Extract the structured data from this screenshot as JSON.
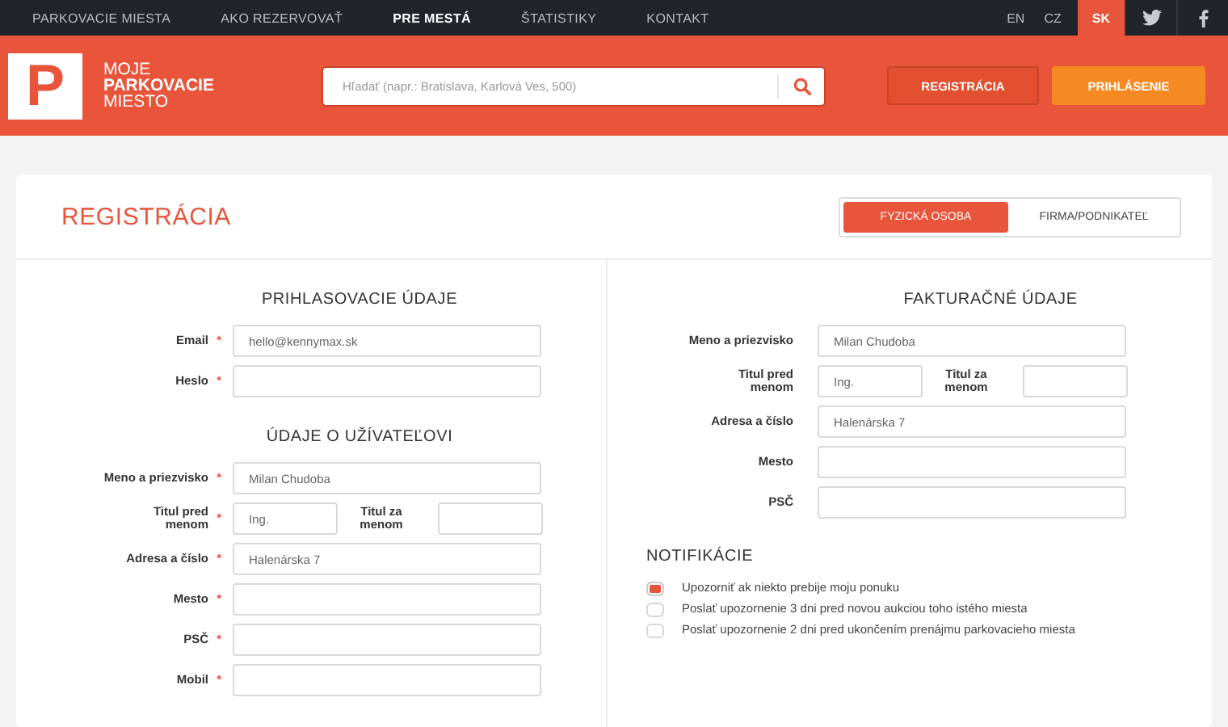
{
  "nav": {
    "items": [
      {
        "label": "PARKOVACIE MIESTA",
        "selected": false
      },
      {
        "label": "AKO REZERVOVAŤ",
        "selected": false
      },
      {
        "label": "PRE MESTÁ",
        "selected": true
      },
      {
        "label": "ŠTATISTIKY",
        "selected": false
      },
      {
        "label": "KONTAKT",
        "selected": false
      }
    ],
    "languages": [
      {
        "label": "EN",
        "selected": false
      },
      {
        "label": "CZ",
        "selected": false
      },
      {
        "label": "SK",
        "selected": true
      }
    ]
  },
  "header": {
    "logo_mark": "P",
    "logo_lines": [
      "MOJE",
      "**PARKOVACIE**",
      "MIESTO"
    ],
    "search": {
      "placeholder": "Hľadať (napr.: Bratislava, Karlová Ves, 500)"
    },
    "buttons": [
      {
        "label": "REGISTRÁCIA",
        "kind": "outline"
      },
      {
        "label": "PRIHLÁSENIE",
        "kind": "primary"
      }
    ]
  },
  "registration": {
    "title": "REGISTRÁCIA",
    "tabs": [
      {
        "label": "FYZICKÁ OSOBA",
        "selected": true
      },
      {
        "label": "FIRMA/PODNIKATEĽ",
        "selected": false
      }
    ],
    "left": [
      {
        "title": "PRIHLASOVACIE ÚDAJE",
        "fields": [
          {
            "kind": "text",
            "label": "Email",
            "marker": "*",
            "value": "hello@kennymax.sk"
          },
          {
            "kind": "text",
            "label": "Heslo",
            "marker": "*"
          }
        ]
      },
      {
        "title": "ÚDAJE O UŽÍVATEĽOVI",
        "fields": [
          {
            "kind": "text",
            "label": "Meno a priezvisko",
            "marker": "*",
            "value": "Milan Chudoba"
          },
          {
            "kind": "pair",
            "items": [
              {
                "label": "Titul pred menom",
                "marker": "*",
                "value": "Ing."
              },
              {
                "label": "Titul za menom"
              }
            ]
          },
          {
            "kind": "text",
            "label": "Adresa a číslo",
            "marker": "*",
            "value": "Halenárska 7"
          },
          {
            "kind": "text",
            "label": "Mesto",
            "marker": "*"
          },
          {
            "kind": "text",
            "label": "PSČ",
            "marker": "*"
          },
          {
            "kind": "text",
            "label": "Mobil",
            "marker": "*"
          }
        ]
      }
    ],
    "right": [
      {
        "title": "FAKTURAČNÉ ÚDAJE",
        "fields": [
          {
            "kind": "text",
            "label": "Meno a priezvisko",
            "value": "Milan Chudoba"
          },
          {
            "kind": "pair",
            "items": [
              {
                "label": "Titul pred menom",
                "value": "Ing."
              },
              {
                "label": "Titul za menom"
              }
            ]
          },
          {
            "kind": "text",
            "label": "Adresa a číslo",
            "value": "Halenárska 7"
          },
          {
            "kind": "text",
            "label": "Mesto"
          },
          {
            "kind": "text",
            "label": "PSČ"
          }
        ]
      }
    ],
    "notifications": {
      "title": "NOTIFIKÁCIE",
      "options": [
        {
          "label": "Upozorniť ak niekto prebije moju ponuku",
          "checked": true
        },
        {
          "label": "Poslať upozornenie 3 dni pred novou aukciou toho istého miesta",
          "checked": false
        },
        {
          "label": "Poslať upozornenie 2 dni pred ukončením prenájmu parkovacieho miesta",
          "checked": false
        }
      ]
    }
  }
}
